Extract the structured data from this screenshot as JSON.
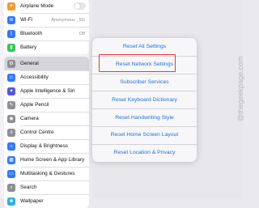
{
  "sidebar": {
    "group1": [
      {
        "label": "Airplane Mode",
        "icon": "airplane-icon",
        "color": "#f19a37",
        "glyph": "✈",
        "toggle": true
      },
      {
        "label": "Wi-Fi",
        "icon": "wifi-icon",
        "color": "#3478f6",
        "glyph": "≋",
        "value": "Anonymous _5G"
      },
      {
        "label": "Bluetooth",
        "icon": "bluetooth-icon",
        "color": "#3478f6",
        "glyph": "ᛒ",
        "value": "Off"
      },
      {
        "label": "Battery",
        "icon": "battery-icon",
        "color": "#34c759",
        "glyph": "▮"
      }
    ],
    "group2": [
      {
        "label": "General",
        "icon": "gear-icon",
        "color": "#8e8e93",
        "glyph": "⚙",
        "selected": true
      },
      {
        "label": "Accessibility",
        "icon": "accessibility-icon",
        "color": "#3478f6",
        "glyph": "☺"
      },
      {
        "label": "Apple Intelligence & Siri",
        "icon": "siri-icon",
        "color": "#5856d6",
        "glyph": "✦"
      },
      {
        "label": "Apple Pencil",
        "icon": "pencil-icon",
        "color": "#8e8e93",
        "glyph": "✎"
      },
      {
        "label": "Camera",
        "icon": "camera-icon",
        "color": "#8e8e93",
        "glyph": "◉"
      },
      {
        "label": "Control Centre",
        "icon": "control-centre-icon",
        "color": "#8e8e93",
        "glyph": "≡"
      },
      {
        "label": "Display & Brightness",
        "icon": "brightness-icon",
        "color": "#3478f6",
        "glyph": "☼"
      },
      {
        "label": "Home Screen & App Library",
        "icon": "home-screen-icon",
        "color": "#3478f6",
        "glyph": "▦"
      },
      {
        "label": "Multitasking & Gestures",
        "icon": "multitasking-icon",
        "color": "#3478f6",
        "glyph": "▭"
      },
      {
        "label": "Search",
        "icon": "search-icon",
        "color": "#8e8e93",
        "glyph": "⌕"
      },
      {
        "label": "Wallpaper",
        "icon": "wallpaper-icon",
        "color": "#32ade6",
        "glyph": "❀"
      }
    ]
  },
  "popover": {
    "items": [
      "Reset All Settings",
      "Reset Network Settings",
      "Subscriber Services",
      "Reset Keyboard Dictionary",
      "Reset Handwriting Style",
      "Reset Home Screen Layout",
      "Reset Location & Privacy"
    ],
    "highlighted_index": 1,
    "highlight_color": "#e53935",
    "text_color": "#1e6fd9"
  },
  "watermark": "@thegeekpage.com"
}
